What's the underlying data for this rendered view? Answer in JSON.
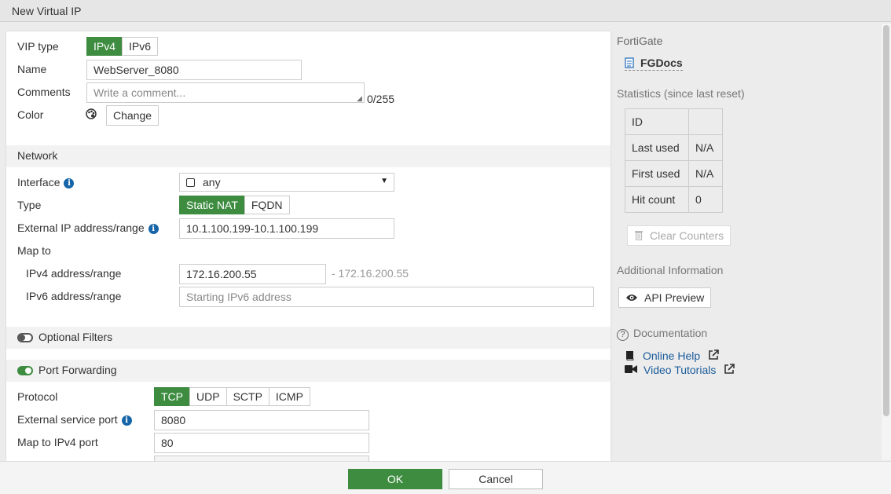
{
  "window": {
    "title": "New Virtual IP"
  },
  "form": {
    "vip_type": {
      "label": "VIP type",
      "options": [
        "IPv4",
        "IPv6"
      ],
      "selected": "IPv4"
    },
    "name": {
      "label": "Name",
      "value": "WebServer_8080"
    },
    "comments": {
      "label": "Comments",
      "placeholder": "Write a comment...",
      "counter": "0/255"
    },
    "color": {
      "label": "Color",
      "button": "Change"
    }
  },
  "network": {
    "section_title": "Network",
    "interface": {
      "label": "Interface",
      "value": "any"
    },
    "type": {
      "label": "Type",
      "options": [
        "Static NAT",
        "FQDN"
      ],
      "selected": "Static NAT"
    },
    "external_ip": {
      "label": "External IP address/range",
      "value": "10.1.100.199-10.1.100.199"
    },
    "map_to": {
      "label": "Map to"
    },
    "ipv4_range": {
      "label": "IPv4 address/range",
      "value": "172.16.200.55",
      "suffix": "- 172.16.200.55"
    },
    "ipv6_range": {
      "label": "IPv6 address/range",
      "placeholder": "Starting IPv6 address"
    }
  },
  "optional_filters": {
    "title": "Optional Filters",
    "enabled": false
  },
  "port_forwarding": {
    "title": "Port Forwarding",
    "enabled": true,
    "protocol": {
      "label": "Protocol",
      "options": [
        "TCP",
        "UDP",
        "SCTP",
        "ICMP"
      ],
      "selected": "TCP"
    },
    "external_port": {
      "label": "External service port",
      "value": "8080"
    },
    "map_ipv4_port": {
      "label": "Map to IPv4 port",
      "value": "80"
    }
  },
  "sidebar": {
    "device": "FortiGate",
    "docs_link": "FGDocs",
    "stats_title": "Statistics (since last reset)",
    "stats": [
      {
        "key": "ID",
        "value": ""
      },
      {
        "key": "Last used",
        "value": "N/A"
      },
      {
        "key": "First used",
        "value": "N/A"
      },
      {
        "key": "Hit count",
        "value": "0"
      }
    ],
    "clear_counters": "Clear Counters",
    "additional_info": "Additional Information",
    "api_preview": "API Preview",
    "documentation": "Documentation",
    "online_help": "Online Help",
    "video_tutorials": "Video Tutorials"
  },
  "footer": {
    "ok": "OK",
    "cancel": "Cancel"
  },
  "colors": {
    "accent": "#3d8c40",
    "link": "#1a5b9a",
    "info": "#1565a8"
  }
}
